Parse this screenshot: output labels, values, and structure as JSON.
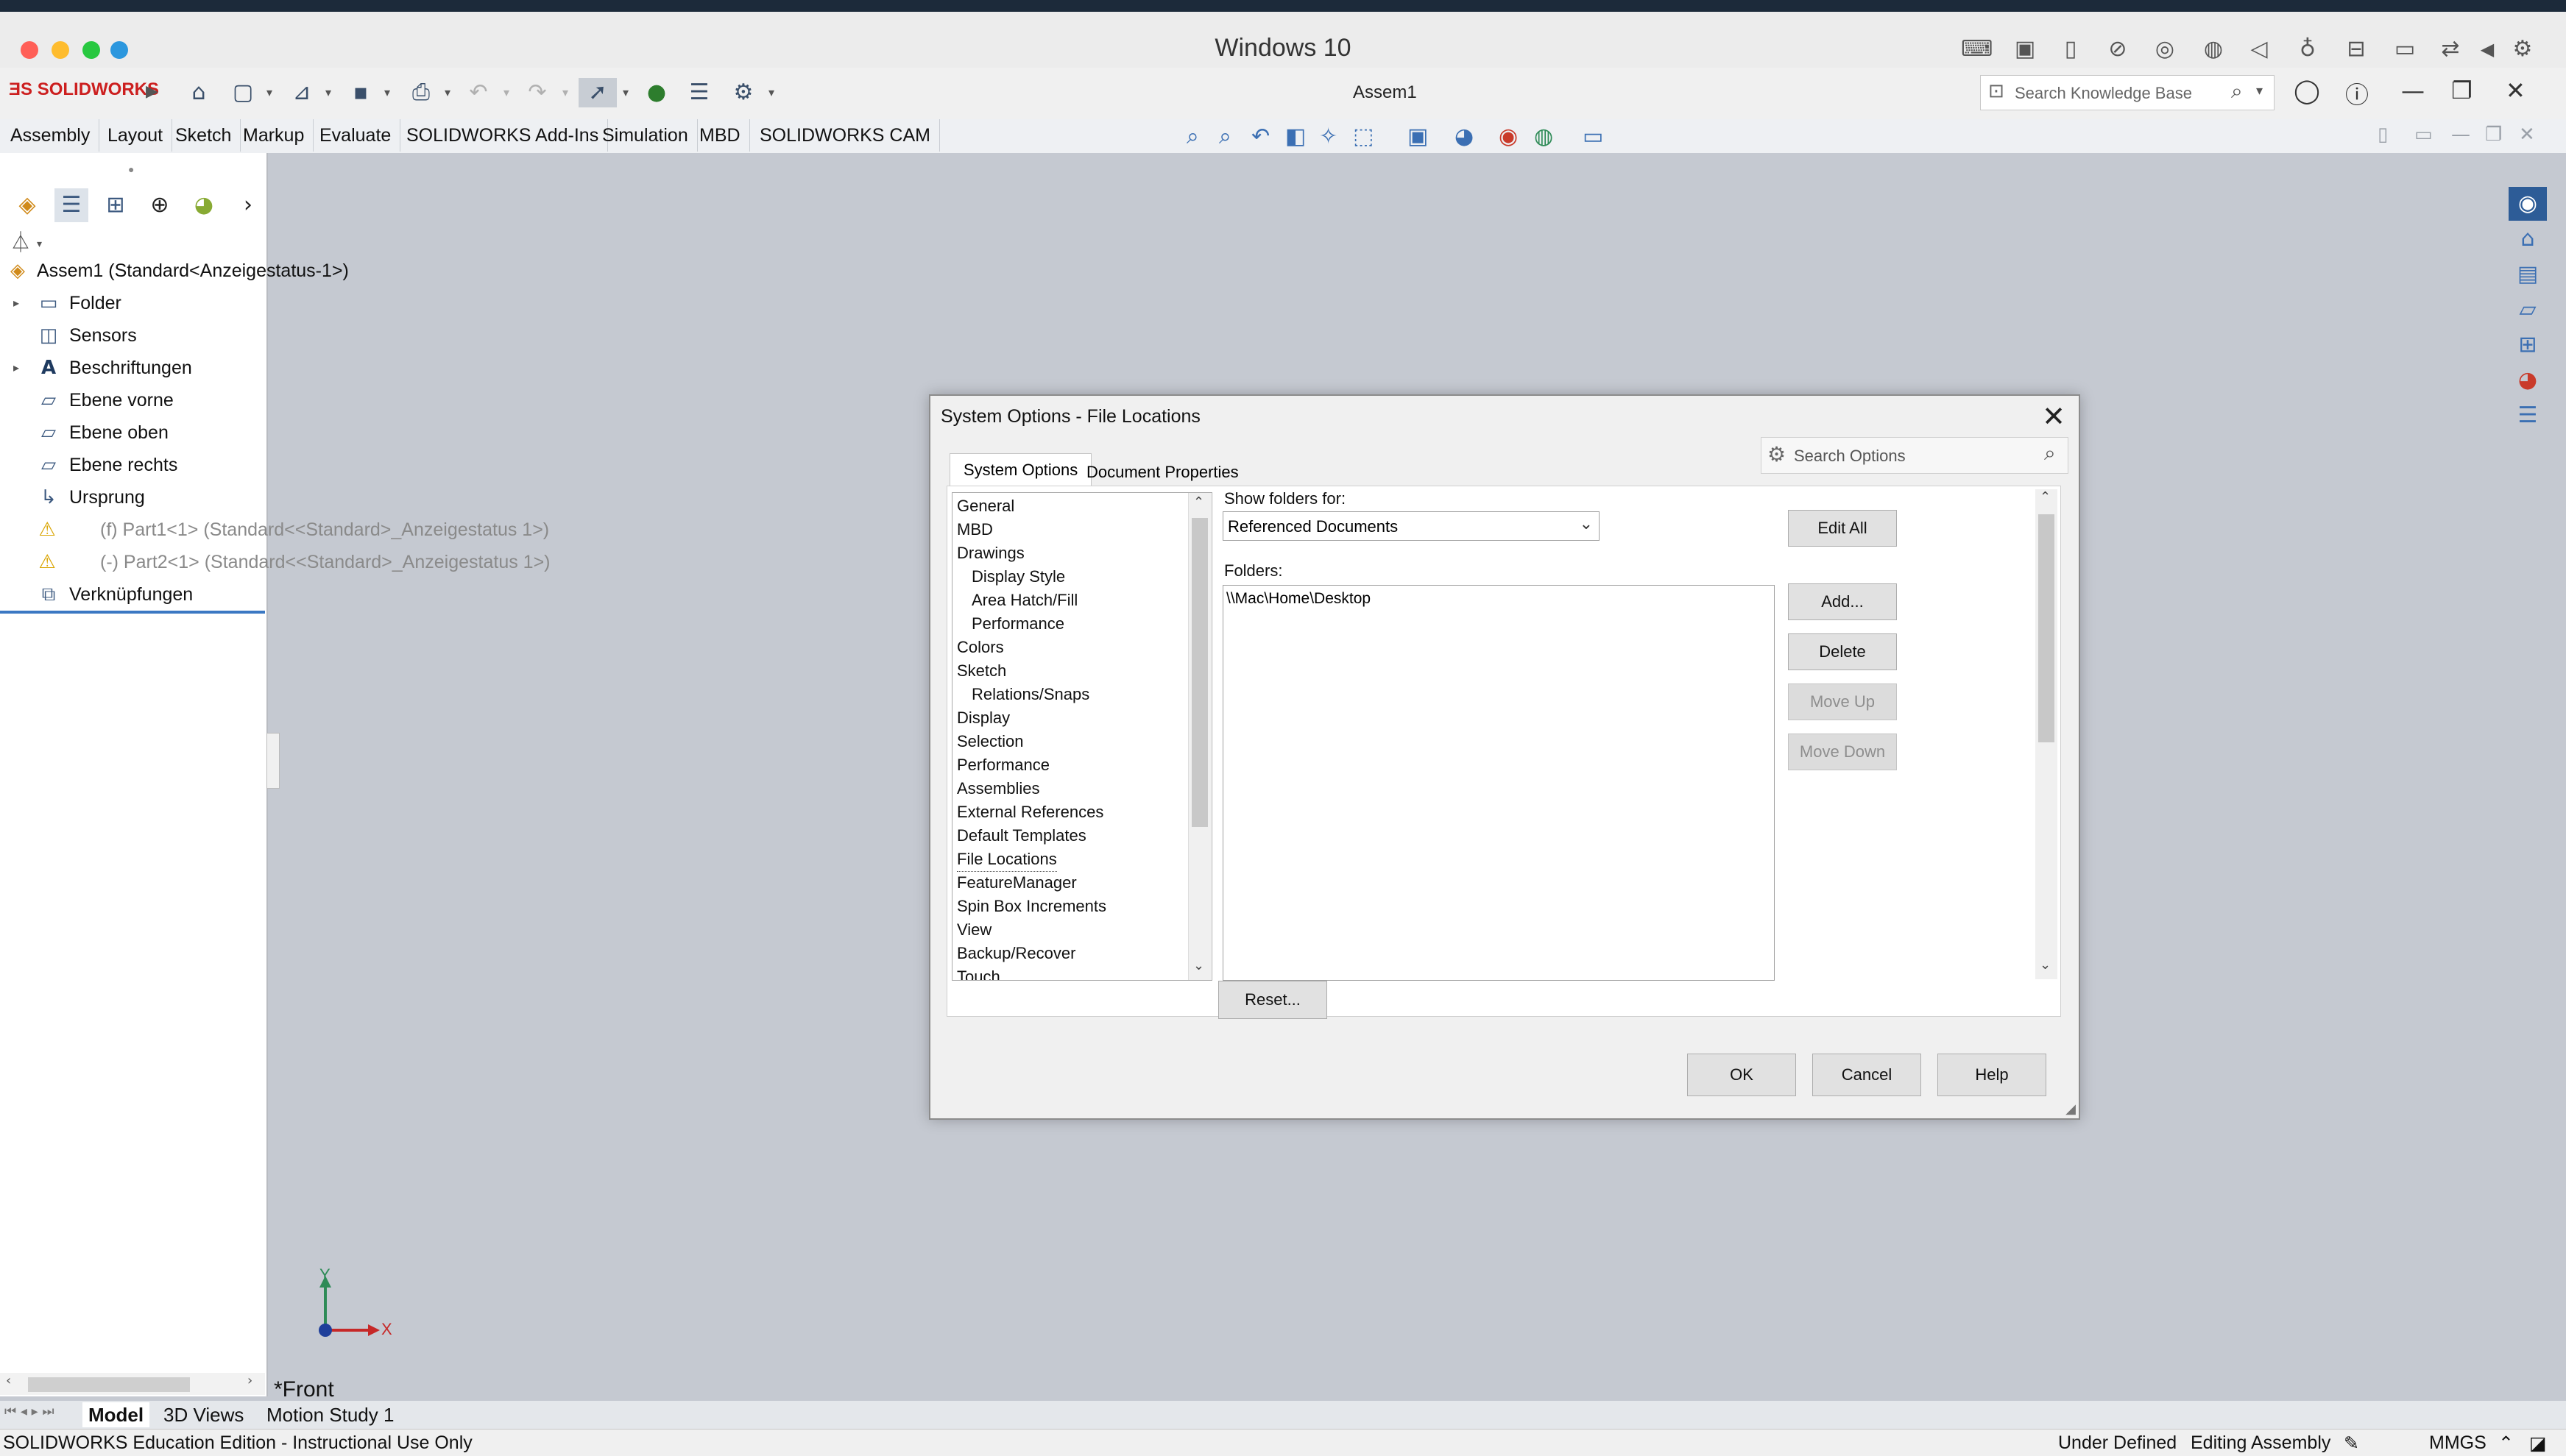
{
  "mac": {
    "title": "Windows 10",
    "traffic_colors": [
      "#ff5f57",
      "#febc2e",
      "#28c840",
      "#2c97de"
    ]
  },
  "sw": {
    "logo": "SOLIDWORKS",
    "doc_title": "Assem1",
    "search_placeholder": "Search Knowledge Base"
  },
  "command_tabs": [
    "Assembly",
    "Layout",
    "Sketch",
    "Markup",
    "Evaluate",
    "SOLIDWORKS Add-Ins",
    "Simulation",
    "MBD",
    "SOLIDWORKS CAM"
  ],
  "tree": {
    "root": "Assem1  (Standard<Anzeigestatus-1>)",
    "items": [
      {
        "label": "Folder",
        "icon": "folder-icon",
        "expand": true,
        "dim": false
      },
      {
        "label": "Sensors",
        "icon": "sensor-icon",
        "expand": false,
        "dim": false
      },
      {
        "label": "Beschriftungen",
        "icon": "annotation-icon",
        "expand": true,
        "dim": false
      },
      {
        "label": "Ebene vorne",
        "icon": "plane-icon",
        "expand": false,
        "dim": false
      },
      {
        "label": "Ebene oben",
        "icon": "plane-icon",
        "expand": false,
        "dim": false
      },
      {
        "label": "Ebene rechts",
        "icon": "plane-icon",
        "expand": false,
        "dim": false
      },
      {
        "label": "Ursprung",
        "icon": "origin-icon",
        "expand": false,
        "dim": false
      },
      {
        "label": "(f) Part1<1> (Standard<<Standard>_Anzeigestatus 1>)",
        "icon": "warning-part-icon",
        "expand": false,
        "dim": true
      },
      {
        "label": "(-) Part2<1> (Standard<<Standard>_Anzeigestatus 1>)",
        "icon": "warning-part-icon",
        "expand": false,
        "dim": true
      },
      {
        "label": "Verknüpfungen",
        "icon": "mates-icon",
        "expand": false,
        "dim": false
      }
    ]
  },
  "dialog": {
    "title": "System Options - File Locations",
    "search_placeholder": "Search Options",
    "tabs": [
      "System Options",
      "Document Properties"
    ],
    "categories": [
      {
        "label": "General",
        "sub": false
      },
      {
        "label": "MBD",
        "sub": false
      },
      {
        "label": "Drawings",
        "sub": false
      },
      {
        "label": "Display Style",
        "sub": true
      },
      {
        "label": "Area Hatch/Fill",
        "sub": true
      },
      {
        "label": "Performance",
        "sub": true
      },
      {
        "label": "Colors",
        "sub": false
      },
      {
        "label": "Sketch",
        "sub": false
      },
      {
        "label": "Relations/Snaps",
        "sub": true
      },
      {
        "label": "Display",
        "sub": false
      },
      {
        "label": "Selection",
        "sub": false
      },
      {
        "label": "Performance",
        "sub": false
      },
      {
        "label": "Assemblies",
        "sub": false
      },
      {
        "label": "External References",
        "sub": false
      },
      {
        "label": "Default Templates",
        "sub": false
      },
      {
        "label": "File Locations",
        "sub": false
      },
      {
        "label": "FeatureManager",
        "sub": false
      },
      {
        "label": "Spin Box Increments",
        "sub": false
      },
      {
        "label": "View",
        "sub": false
      },
      {
        "label": "Backup/Recover",
        "sub": false
      },
      {
        "label": "Touch",
        "sub": false
      }
    ],
    "show_folders_label": "Show folders for:",
    "show_folders_value": "Referenced Documents",
    "folders_label": "Folders:",
    "folders": [
      "\\\\Mac\\Home\\Desktop"
    ],
    "buttons": {
      "edit_all": "Edit All",
      "add": "Add...",
      "delete": "Delete",
      "move_up": "Move Up",
      "move_down": "Move Down",
      "reset": "Reset...",
      "ok": "OK",
      "cancel": "Cancel",
      "help": "Help"
    }
  },
  "viewport": {
    "view_name": "*Front",
    "triad": {
      "y": "Y",
      "x": "X"
    }
  },
  "model_tabs": [
    "Model",
    "3D Views",
    "Motion Study 1"
  ],
  "status": {
    "left": "SOLIDWORKS Education Edition - Instructional Use Only",
    "state": "Under Defined",
    "mode": "Editing Assembly",
    "units": "MMGS"
  }
}
